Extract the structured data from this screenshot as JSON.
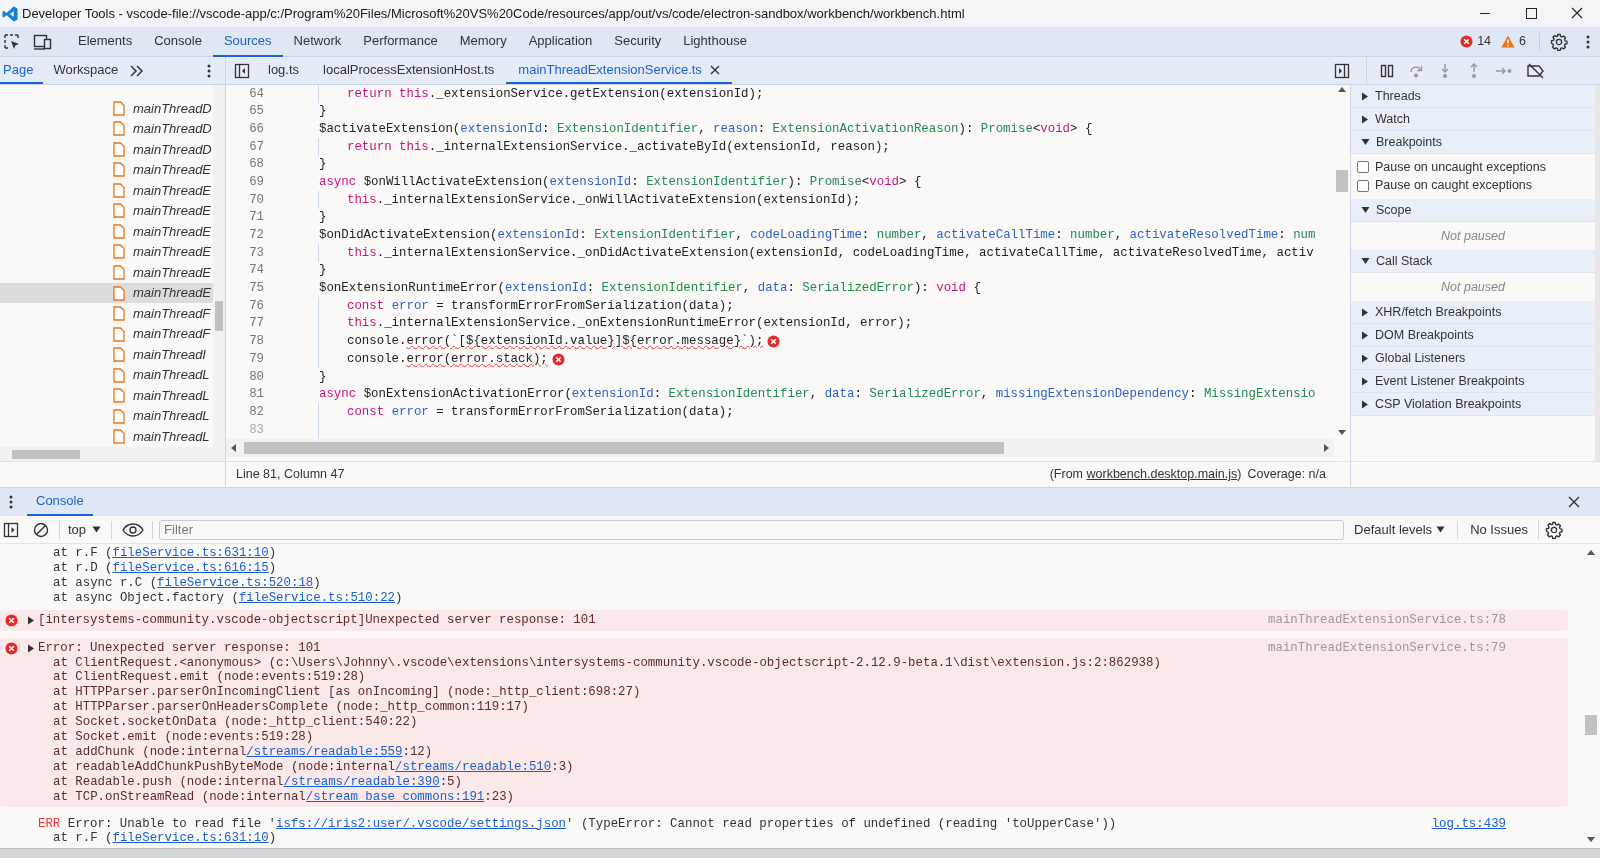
{
  "window": {
    "title": "Developer Tools - vscode-file://vscode-app/c:/Program%20Files/Microsoft%20VS%20Code/resources/app/out/vs/code/electron-sandbox/workbench/workbench.html"
  },
  "toolbar": {
    "tabs": [
      {
        "label": "Elements",
        "selected": false
      },
      {
        "label": "Console",
        "selected": false
      },
      {
        "label": "Sources",
        "selected": true
      },
      {
        "label": "Network",
        "selected": false
      },
      {
        "label": "Performance",
        "selected": false
      },
      {
        "label": "Memory",
        "selected": false
      },
      {
        "label": "Application",
        "selected": false
      },
      {
        "label": "Security",
        "selected": false
      },
      {
        "label": "Lighthouse",
        "selected": false
      }
    ],
    "errors": "14",
    "warnings": "6"
  },
  "sources": {
    "navigator_tabs": [
      {
        "label": "Page",
        "selected": true
      },
      {
        "label": "Workspace",
        "selected": false
      }
    ],
    "files": [
      {
        "name": "mainThreadD",
        "selected": false
      },
      {
        "name": "mainThreadD",
        "selected": false
      },
      {
        "name": "mainThreadD",
        "selected": false
      },
      {
        "name": "mainThreadE",
        "selected": false
      },
      {
        "name": "mainThreadE",
        "selected": false
      },
      {
        "name": "mainThreadE",
        "selected": false
      },
      {
        "name": "mainThreadE",
        "selected": false
      },
      {
        "name": "mainThreadE",
        "selected": false
      },
      {
        "name": "mainThreadE",
        "selected": false
      },
      {
        "name": "mainThreadE",
        "selected": true
      },
      {
        "name": "mainThreadF",
        "selected": false
      },
      {
        "name": "mainThreadF",
        "selected": false
      },
      {
        "name": "mainThreadI",
        "selected": false
      },
      {
        "name": "mainThreadL",
        "selected": false
      },
      {
        "name": "mainThreadL",
        "selected": false
      },
      {
        "name": "mainThreadL",
        "selected": false
      },
      {
        "name": "mainThreadL",
        "selected": false
      }
    ],
    "editor_tabs": [
      {
        "label": "log.ts",
        "selected": false,
        "closable": false
      },
      {
        "label": "localProcessExtensionHost.ts",
        "selected": false,
        "closable": false
      },
      {
        "label": "mainThreadExtensionService.ts",
        "selected": true,
        "closable": true
      }
    ],
    "code": [
      {
        "line": "64",
        "indented": true,
        "error": false,
        "tokens": [
          {
            "kind": "kw",
            "t": "return this"
          },
          {
            "kind": "plain",
            "t": "._extensionService.getExtension(extensionId);"
          }
        ]
      },
      {
        "line": "65",
        "indented": false,
        "error": false,
        "tokens": [
          {
            "kind": "plain",
            "t": "}"
          }
        ]
      },
      {
        "line": "66",
        "indented": false,
        "error": false,
        "tokens": [
          {
            "kind": "plain",
            "t": "$activateExtension("
          },
          {
            "kind": "param",
            "t": "extensionId"
          },
          {
            "kind": "plain",
            "t": ": "
          },
          {
            "kind": "type",
            "t": "ExtensionIdentifier"
          },
          {
            "kind": "plain",
            "t": ", "
          },
          {
            "kind": "param",
            "t": "reason"
          },
          {
            "kind": "plain",
            "t": ": "
          },
          {
            "kind": "type",
            "t": "ExtensionActivationReason"
          },
          {
            "kind": "plain",
            "t": "): "
          },
          {
            "kind": "type",
            "t": "Promise"
          },
          {
            "kind": "plain",
            "t": "<"
          },
          {
            "kind": "kw",
            "t": "void"
          },
          {
            "kind": "plain",
            "t": "> {"
          }
        ]
      },
      {
        "line": "67",
        "indented": true,
        "error": false,
        "tokens": [
          {
            "kind": "kw",
            "t": "return this"
          },
          {
            "kind": "plain",
            "t": "._internalExtensionService._activateById(extensionId, reason);"
          }
        ]
      },
      {
        "line": "68",
        "indented": false,
        "error": false,
        "tokens": [
          {
            "kind": "plain",
            "t": "}"
          }
        ]
      },
      {
        "line": "69",
        "indented": false,
        "error": false,
        "tokens": [
          {
            "kind": "kw",
            "t": "async "
          },
          {
            "kind": "plain",
            "t": "$onWillActivateExtension("
          },
          {
            "kind": "param",
            "t": "extensionId"
          },
          {
            "kind": "plain",
            "t": ": "
          },
          {
            "kind": "type",
            "t": "ExtensionIdentifier"
          },
          {
            "kind": "plain",
            "t": "): "
          },
          {
            "kind": "type",
            "t": "Promise"
          },
          {
            "kind": "plain",
            "t": "<"
          },
          {
            "kind": "kw",
            "t": "void"
          },
          {
            "kind": "plain",
            "t": "> {"
          }
        ]
      },
      {
        "line": "70",
        "indented": true,
        "error": false,
        "tokens": [
          {
            "kind": "kw",
            "t": "this"
          },
          {
            "kind": "plain",
            "t": "._internalExtensionService._onWillActivateExtension(extensionId);"
          }
        ]
      },
      {
        "line": "71",
        "indented": false,
        "error": false,
        "tokens": [
          {
            "kind": "plain",
            "t": "}"
          }
        ]
      },
      {
        "line": "72",
        "indented": false,
        "error": false,
        "tokens": [
          {
            "kind": "plain",
            "t": "$onDidActivateExtension("
          },
          {
            "kind": "param",
            "t": "extensionId"
          },
          {
            "kind": "plain",
            "t": ": "
          },
          {
            "kind": "type",
            "t": "ExtensionIdentifier"
          },
          {
            "kind": "plain",
            "t": ", "
          },
          {
            "kind": "param",
            "t": "codeLoadingTime"
          },
          {
            "kind": "plain",
            "t": ": "
          },
          {
            "kind": "type",
            "t": "number"
          },
          {
            "kind": "plain",
            "t": ", "
          },
          {
            "kind": "param",
            "t": "activateCallTime"
          },
          {
            "kind": "plain",
            "t": ": "
          },
          {
            "kind": "type",
            "t": "number"
          },
          {
            "kind": "plain",
            "t": ", "
          },
          {
            "kind": "param",
            "t": "activateResolvedTime"
          },
          {
            "kind": "plain",
            "t": ": "
          },
          {
            "kind": "type",
            "t": "num"
          }
        ]
      },
      {
        "line": "73",
        "indented": true,
        "error": false,
        "tokens": [
          {
            "kind": "kw",
            "t": "this"
          },
          {
            "kind": "plain",
            "t": "._internalExtensionService._onDidActivateExtension(extensionId, codeLoadingTime, activateCallTime, activateResolvedTime, activ"
          }
        ]
      },
      {
        "line": "74",
        "indented": false,
        "error": false,
        "tokens": [
          {
            "kind": "plain",
            "t": "}"
          }
        ]
      },
      {
        "line": "75",
        "indented": false,
        "error": false,
        "tokens": [
          {
            "kind": "plain",
            "t": "$onExtensionRuntimeError("
          },
          {
            "kind": "param",
            "t": "extensionId"
          },
          {
            "kind": "plain",
            "t": ": "
          },
          {
            "kind": "type",
            "t": "ExtensionIdentifier"
          },
          {
            "kind": "plain",
            "t": ", "
          },
          {
            "kind": "param",
            "t": "data"
          },
          {
            "kind": "plain",
            "t": ": "
          },
          {
            "kind": "type",
            "t": "SerializedError"
          },
          {
            "kind": "plain",
            "t": "): "
          },
          {
            "kind": "kw",
            "t": "void"
          },
          {
            "kind": "plain",
            "t": " {"
          }
        ]
      },
      {
        "line": "76",
        "indented": true,
        "error": false,
        "tokens": [
          {
            "kind": "kw",
            "t": "const "
          },
          {
            "kind": "param",
            "t": "error"
          },
          {
            "kind": "plain",
            "t": " = transformErrorFromSerialization(data);"
          }
        ]
      },
      {
        "line": "77",
        "indented": true,
        "error": false,
        "tokens": [
          {
            "kind": "kw",
            "t": "this"
          },
          {
            "kind": "plain",
            "t": "._internalExtensionService._onExtensionRuntimeError(extensionId, error);"
          }
        ]
      },
      {
        "line": "78",
        "indented": true,
        "error": true,
        "tokens": [
          {
            "kind": "plain",
            "t": "console."
          },
          {
            "kind": "err",
            "t": "error(`[${extensionId.value}]${error.message}`);"
          }
        ]
      },
      {
        "line": "79",
        "indented": true,
        "error": true,
        "tokens": [
          {
            "kind": "plain",
            "t": "console."
          },
          {
            "kind": "err",
            "t": "error(error.stack);"
          }
        ]
      },
      {
        "line": "80",
        "indented": false,
        "error": false,
        "tokens": [
          {
            "kind": "plain",
            "t": "}"
          }
        ]
      },
      {
        "line": "81",
        "indented": false,
        "error": false,
        "tokens": [
          {
            "kind": "kw",
            "t": "async "
          },
          {
            "kind": "plain",
            "t": "$onExtensionActivationError("
          },
          {
            "kind": "param",
            "t": "extensionId"
          },
          {
            "kind": "plain",
            "t": ": "
          },
          {
            "kind": "type",
            "t": "ExtensionIdentifier"
          },
          {
            "kind": "plain",
            "t": ", "
          },
          {
            "kind": "param",
            "t": "data"
          },
          {
            "kind": "plain",
            "t": ": "
          },
          {
            "kind": "type",
            "t": "SerializedError"
          },
          {
            "kind": "plain",
            "t": ", "
          },
          {
            "kind": "param",
            "t": "missingExtensionDependency"
          },
          {
            "kind": "plain",
            "t": ": "
          },
          {
            "kind": "type",
            "t": "MissingExtensio"
          }
        ]
      },
      {
        "line": "82",
        "indented": true,
        "error": false,
        "tokens": [
          {
            "kind": "kw",
            "t": "const "
          },
          {
            "kind": "param",
            "t": "error"
          },
          {
            "kind": "plain",
            "t": " = transformErrorFromSerialization(data);"
          }
        ]
      },
      {
        "line": "83",
        "indented": true,
        "error": false
      }
    ],
    "status": {
      "position": "Line 81, Column 47",
      "from_prefix": "(From ",
      "from_link": "workbench.desktop.main.js",
      "from_suffix": ")",
      "coverage": "Coverage: n/a"
    }
  },
  "debugger": {
    "sections": [
      {
        "title": "Threads",
        "expanded": false
      },
      {
        "title": "Watch",
        "expanded": false
      },
      {
        "title": "Breakpoints",
        "expanded": true,
        "checkboxes": [
          {
            "label": "Pause on uncaught exceptions",
            "checked": false
          },
          {
            "label": "Pause on caught exceptions",
            "checked": false
          }
        ]
      },
      {
        "title": "Scope",
        "expanded": true,
        "message": "Not paused"
      },
      {
        "title": "Call Stack",
        "expanded": true,
        "message": "Not paused"
      },
      {
        "title": "XHR/fetch Breakpoints",
        "expanded": false
      },
      {
        "title": "DOM Breakpoints",
        "expanded": false
      },
      {
        "title": "Global Listeners",
        "expanded": false
      },
      {
        "title": "Event Listener Breakpoints",
        "expanded": false
      },
      {
        "title": "CSP Violation Breakpoints",
        "expanded": false
      }
    ]
  },
  "console": {
    "tab": {
      "label": "Console",
      "selected": true
    },
    "context": "top",
    "filter_placeholder": "Filter",
    "levels": "Default levels",
    "issues": "No Issues",
    "messages": [
      {
        "kind": "trace",
        "lines": [
          {
            "pre": "at r.F (",
            "link": "fileService.ts:631:10",
            "post": ")"
          },
          {
            "pre": "at r.D (",
            "link": "fileService.ts:616:15",
            "post": ")"
          },
          {
            "pre": "at async r.C (",
            "link": "fileService.ts:520:18",
            "post": ")"
          },
          {
            "pre": "at async Object.factory (",
            "link": "fileService.ts:510:22",
            "post": ")"
          }
        ]
      },
      {
        "kind": "error",
        "text": "[intersystems-community.vscode-objectscript]Unexpected server response: 101",
        "source": "mainThreadExtensionService.ts:78"
      },
      {
        "kind": "error",
        "text": "Error: Unexpected server response: 101",
        "source": "mainThreadExtensionService.ts:79",
        "lines": [
          {
            "pre": "at ClientRequest.<anonymous> (c:\\Users\\Johnny\\.vscode\\extensions\\intersystems-community.vscode-objectscript-2.12.9-beta.1\\dist\\extension.js:2:862938)"
          },
          {
            "pre": "at ClientRequest.emit (node:events:519:28)"
          },
          {
            "pre": "at HTTPParser.parserOnIncomingClient [as onIncoming] (node:_http_client:698:27)"
          },
          {
            "pre": "at HTTPParser.parserOnHeadersComplete (node:_http_common:119:17)"
          },
          {
            "pre": "at Socket.socketOnData (node:_http_client:540:22)"
          },
          {
            "pre": "at Socket.emit (node:events:519:28)"
          },
          {
            "pre": "at addChunk (node:internal",
            "link": "/streams/readable:559",
            "post": ":12)"
          },
          {
            "pre": "at readableAddChunkPushByteMode (node:internal",
            "link": "/streams/readable:510",
            "post": ":3)"
          },
          {
            "pre": "at Readable.push (node:internal",
            "link": "/streams/readable:390",
            "post": ":5)"
          },
          {
            "pre": "at TCP.onStreamRead (node:internal",
            "link": "/stream_base_commons:191",
            "post": ":23)"
          }
        ]
      },
      {
        "kind": "log",
        "level": "ERR",
        "pre": "Error: Unable to read file '",
        "link": "isfs://iris2:user/.vscode/settings.json",
        "post": "' (TypeError: Cannot read properties of undefined (reading 'toUpperCase'))",
        "source": "log.ts:439",
        "lines": [
          {
            "pre": "at r.F (",
            "link": "fileService.ts:631:10",
            "post": ")"
          }
        ]
      }
    ]
  }
}
